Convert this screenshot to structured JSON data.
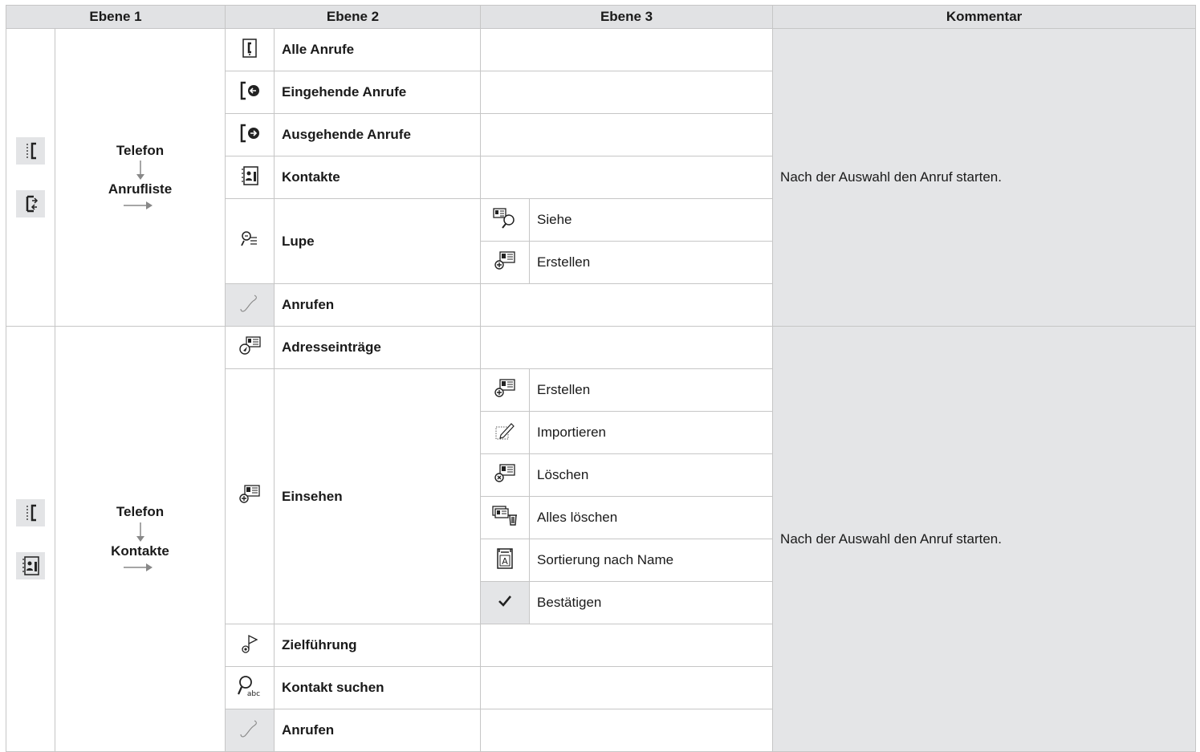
{
  "header": {
    "col_level1": "Ebene 1",
    "col_level2": "Ebene 2",
    "col_level3": "Ebene 3",
    "col_comment": "Kommentar"
  },
  "block1": {
    "path_top": "Telefon",
    "path_bottom": "Anrufliste",
    "level1_icons": [
      "phone-menu-icon",
      "call-log-icon"
    ],
    "comment": "Nach der Auswahl den Anruf starten.",
    "rows": [
      {
        "icon": "call-list-icon",
        "label": "Alle Anrufe"
      },
      {
        "icon": "incoming-calls-icon",
        "label": "Eingehende Anrufe"
      },
      {
        "icon": "outgoing-calls-icon",
        "label": "Ausgehende Anrufe"
      },
      {
        "icon": "contacts-book-icon",
        "label": "Kontakte"
      },
      {
        "icon": "magnifier-list-icon",
        "label": "Lupe",
        "sub": [
          {
            "icon": "view-card-icon",
            "label": "Siehe"
          },
          {
            "icon": "create-card-icon",
            "label": "Erstellen"
          }
        ]
      },
      {
        "icon": "handset-icon",
        "label": "Anrufen"
      }
    ]
  },
  "block2": {
    "path_top": "Telefon",
    "path_bottom": "Kontakte",
    "level1_icons": [
      "phone-menu-icon",
      "contacts-book-icon"
    ],
    "comment": "Nach der Auswahl den Anruf starten.",
    "rows": [
      {
        "icon": "address-entry-icon",
        "label": "Adresseinträge"
      },
      {
        "icon": "view-contact-icon",
        "label": "Einsehen",
        "sub": [
          {
            "icon": "create-card-icon",
            "label": "Erstellen"
          },
          {
            "icon": "import-icon",
            "label": "Importieren"
          },
          {
            "icon": "delete-card-icon",
            "label": "Löschen"
          },
          {
            "icon": "delete-all-icon",
            "label": "Alles löschen"
          },
          {
            "icon": "sort-by-name-icon",
            "label": "Sortierung nach Name"
          },
          {
            "icon": "checkmark-icon",
            "label": "Bestätigen"
          }
        ]
      },
      {
        "icon": "navigation-flag-icon",
        "label": "Zielführung"
      },
      {
        "icon": "search-contact-icon",
        "label": "Kontakt suchen"
      },
      {
        "icon": "handset-icon",
        "label": "Anrufen"
      }
    ]
  }
}
